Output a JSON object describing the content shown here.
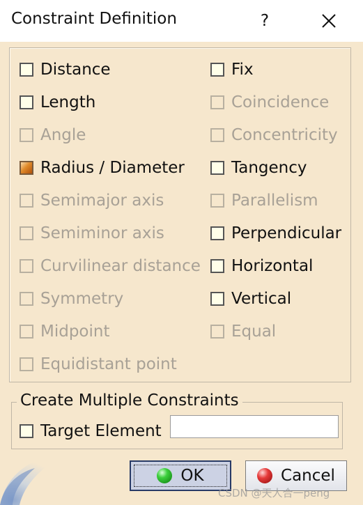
{
  "title": {
    "text": "Constraint Definition",
    "help_glyph": "?",
    "close_icon": "close-icon"
  },
  "constraints": {
    "left": [
      {
        "label": "Distance",
        "enabled": true,
        "checked": false
      },
      {
        "label": "Length",
        "enabled": true,
        "checked": false
      },
      {
        "label": "Angle",
        "enabled": false,
        "checked": false
      },
      {
        "label": "Radius / Diameter",
        "enabled": true,
        "checked": true
      },
      {
        "label": "Semimajor axis",
        "enabled": false,
        "checked": false
      },
      {
        "label": "Semiminor axis",
        "enabled": false,
        "checked": false
      },
      {
        "label": "Curvilinear distance",
        "enabled": false,
        "checked": false
      },
      {
        "label": "Symmetry",
        "enabled": false,
        "checked": false
      },
      {
        "label": "Midpoint",
        "enabled": false,
        "checked": false
      },
      {
        "label": "Equidistant point",
        "enabled": false,
        "checked": false
      }
    ],
    "right": [
      {
        "label": "Fix",
        "enabled": true,
        "checked": false
      },
      {
        "label": "Coincidence",
        "enabled": false,
        "checked": false
      },
      {
        "label": "Concentricity",
        "enabled": false,
        "checked": false
      },
      {
        "label": "Tangency",
        "enabled": true,
        "checked": false
      },
      {
        "label": "Parallelism",
        "enabled": false,
        "checked": false
      },
      {
        "label": "Perpendicular",
        "enabled": true,
        "checked": false
      },
      {
        "label": "Horizontal",
        "enabled": true,
        "checked": false
      },
      {
        "label": "Vertical",
        "enabled": true,
        "checked": false
      },
      {
        "label": "Equal",
        "enabled": false,
        "checked": false
      }
    ]
  },
  "multiple": {
    "legend": "Create Multiple Constraints",
    "target_label": "Target Element",
    "target_checked": false,
    "target_value": ""
  },
  "buttons": {
    "ok_label": "OK",
    "cancel_label": "Cancel"
  },
  "watermark": "CSDN @天人合一peng",
  "colors": {
    "dialog_bg": "#f6e7cd",
    "disabled_text": "#a8a196",
    "ok_icon": "#3ccf3c",
    "cancel_icon": "#e63a3a"
  }
}
